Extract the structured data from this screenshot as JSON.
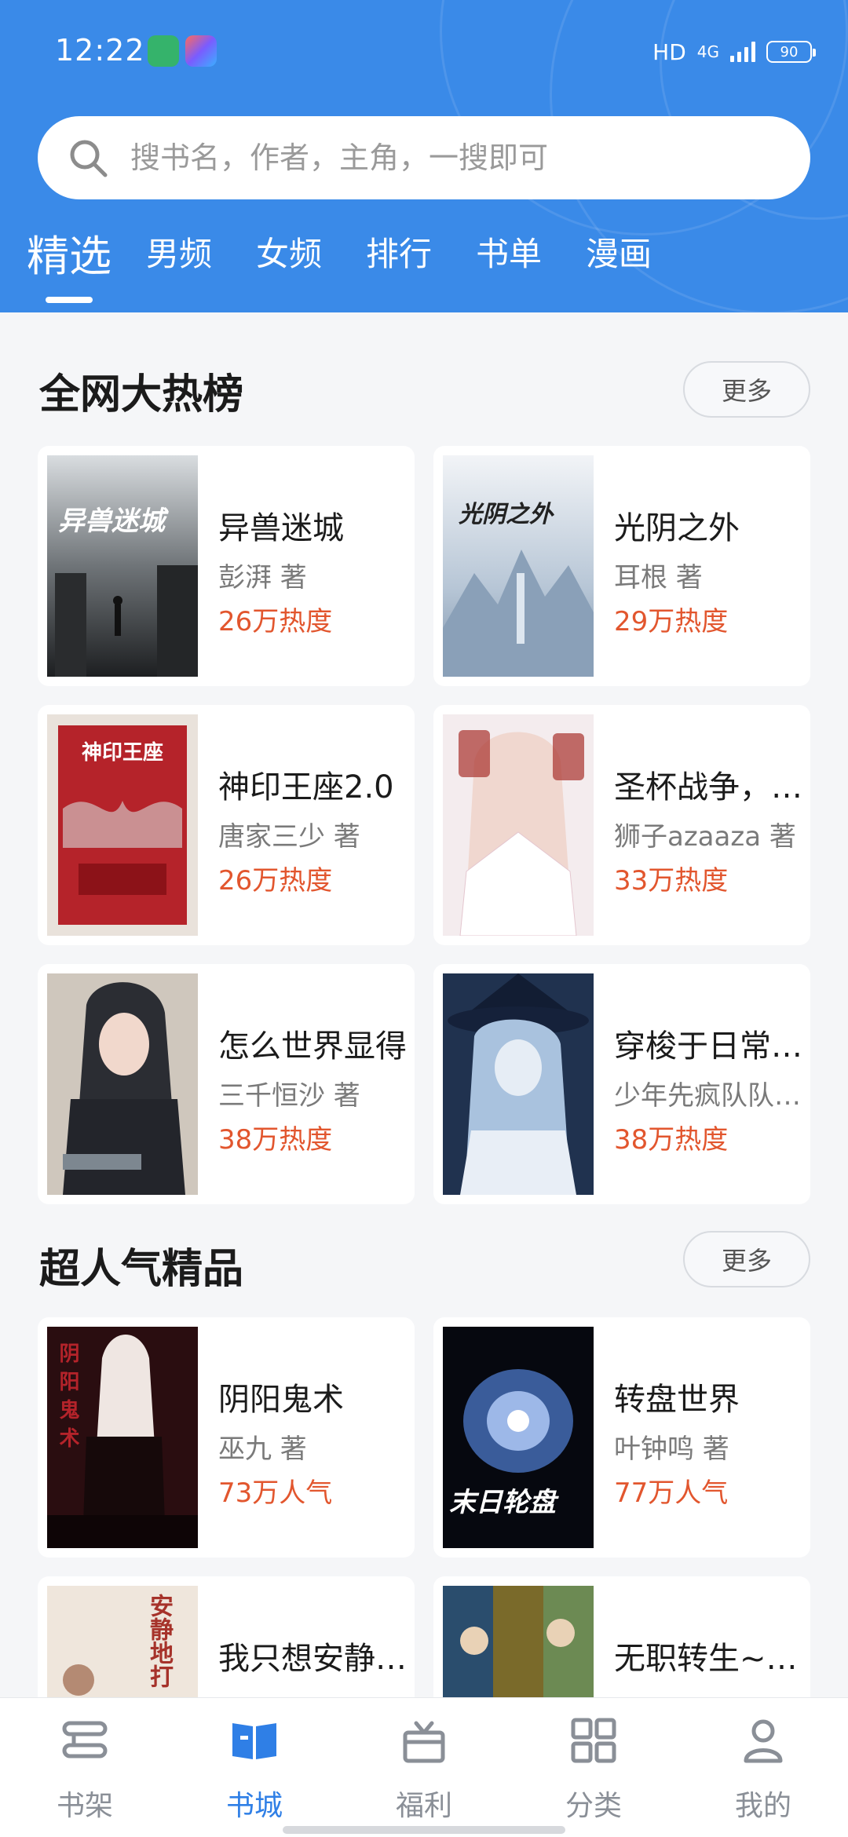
{
  "status_bar": {
    "time": "12:22",
    "net_label": "HD",
    "net_type": "4G",
    "battery": "90"
  },
  "search": {
    "placeholder": "搜书名，作者，主角，一搜即可"
  },
  "tabs": [
    {
      "label": "精选",
      "active": true
    },
    {
      "label": "男频"
    },
    {
      "label": "女频"
    },
    {
      "label": "排行"
    },
    {
      "label": "书单"
    },
    {
      "label": "漫画"
    }
  ],
  "sections": [
    {
      "title": "全网大热榜",
      "more": "更多",
      "books": [
        {
          "title": "异兽迷城",
          "author": "彭湃 著",
          "heat": "26万热度",
          "cover_text": "异兽迷城"
        },
        {
          "title": "光阴之外",
          "author": "耳根  著",
          "heat": "29万热度",
          "cover_text": "光阴之外"
        },
        {
          "title": "神印王座2.0",
          "author": "唐家三少 著",
          "heat": "26万热度",
          "cover_text": "神印王座"
        },
        {
          "title": "圣杯战争，我的从者",
          "author": "狮子azaaza 著",
          "heat": "33万热度",
          "cover_text": ""
        },
        {
          "title": "怎么世界显得",
          "author": "三千恒沙 著",
          "heat": "38万热度",
          "cover_text": ""
        },
        {
          "title": "穿梭于日常世界",
          "author": "少年先疯队队长 著",
          "heat": "38万热度",
          "cover_text": ""
        }
      ]
    },
    {
      "title": "超人气精品",
      "more": "更多",
      "books": [
        {
          "title": "阴阳鬼术",
          "author": "巫九 著",
          "heat": "73万人气",
          "cover_text": "阴阳鬼术"
        },
        {
          "title": "转盘世界",
          "author": "叶钟鸣 著",
          "heat": "77万人气",
          "cover_text": "末日轮盘"
        },
        {
          "title": "我只想安静的打游戏",
          "author": "",
          "heat": "",
          "cover_text": "安静地打"
        },
        {
          "title": "无职转生~到了异世界就拿出真本事~",
          "author": "",
          "heat": "",
          "cover_text": ""
        }
      ]
    }
  ],
  "bottom_nav": [
    {
      "label": "书架",
      "icon": "bookshelf-icon"
    },
    {
      "label": "书城",
      "icon": "book-open-icon",
      "active": true
    },
    {
      "label": "福利",
      "icon": "gift-icon"
    },
    {
      "label": "分类",
      "icon": "grid-icon"
    },
    {
      "label": "我的",
      "icon": "user-icon"
    }
  ],
  "colors": {
    "brand": "#3a8ae8",
    "heat": "#e2562e",
    "nav_active": "#2f7fe6"
  }
}
